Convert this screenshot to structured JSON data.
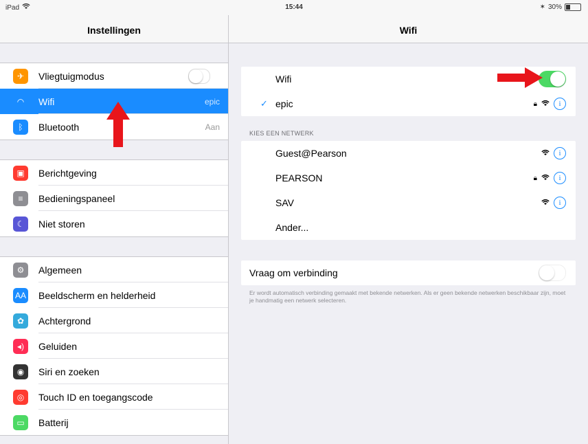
{
  "status_bar": {
    "device": "iPad",
    "time": "15:44",
    "battery": "30%",
    "battery_level": 0.3
  },
  "sidebar": {
    "title": "Instellingen",
    "groups": [
      [
        {
          "label": "Vliegtuigmodus",
          "icon": "airplane-icon",
          "color": "#ff9500",
          "toggle": false
        },
        {
          "label": "Wifi",
          "icon": "wifi-icon",
          "color": "#1a8cff",
          "value": "epic",
          "selected": true
        },
        {
          "label": "Bluetooth",
          "icon": "bluetooth-icon",
          "color": "#1a8cff",
          "value": "Aan"
        }
      ],
      [
        {
          "label": "Berichtgeving",
          "icon": "notifications-icon",
          "color": "#ff3b30"
        },
        {
          "label": "Bedieningspaneel",
          "icon": "control-center-icon",
          "color": "#8e8e93"
        },
        {
          "label": "Niet storen",
          "icon": "moon-icon",
          "color": "#5856d6"
        }
      ],
      [
        {
          "label": "Algemeen",
          "icon": "gear-icon",
          "color": "#8e8e93"
        },
        {
          "label": "Beeldscherm en helderheid",
          "icon": "display-icon",
          "color": "#1a8cff"
        },
        {
          "label": "Achtergrond",
          "icon": "wallpaper-icon",
          "color": "#34aadc"
        },
        {
          "label": "Geluiden",
          "icon": "speaker-icon",
          "color": "#ff2d55"
        },
        {
          "label": "Siri en zoeken",
          "icon": "siri-icon",
          "color": "#333333"
        },
        {
          "label": "Touch ID en toegangscode",
          "icon": "fingerprint-icon",
          "color": "#ff3b30"
        },
        {
          "label": "Batterij",
          "icon": "battery-icon",
          "color": "#4cd964"
        }
      ]
    ]
  },
  "main": {
    "title": "Wifi",
    "wifi_toggle_label": "Wifi",
    "wifi_enabled": true,
    "connected_network": "epic",
    "section_label": "KIES EEN NETWERK",
    "networks": [
      {
        "name": "Guest@Pearson",
        "locked": false
      },
      {
        "name": "PEARSON",
        "locked": true
      },
      {
        "name": "SAV",
        "locked": false
      },
      {
        "name": "Ander...",
        "other": true
      }
    ],
    "ask_to_join_label": "Vraag om verbinding",
    "ask_to_join_enabled": false,
    "footnote": "Er wordt automatisch verbinding gemaakt met bekende netwerken. Als er geen bekende netwerken beschikbaar zijn, moet je handmatig een netwerk selecteren."
  },
  "colors": {
    "accent": "#1a8cff",
    "toggle_on": "#4cd964",
    "arrow": "#e8151b"
  }
}
